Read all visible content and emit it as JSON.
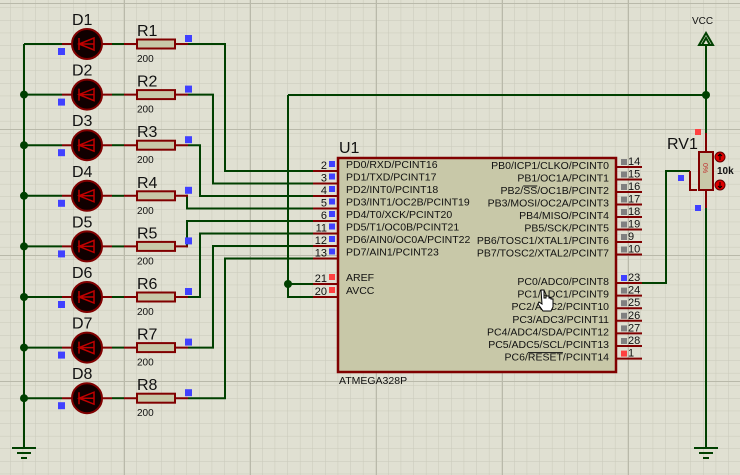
{
  "colors": {
    "wire": "#004000",
    "component": "#800000",
    "body": "#c8c8a8",
    "background": "#e0e0d2",
    "pin_low": "#4040ff",
    "pin_high": "#ff4040",
    "pin_float": "#808080"
  },
  "leds": [
    {
      "label": "D1"
    },
    {
      "label": "D2"
    },
    {
      "label": "D3"
    },
    {
      "label": "D4"
    },
    {
      "label": "D5"
    },
    {
      "label": "D6"
    },
    {
      "label": "D7"
    },
    {
      "label": "D8"
    }
  ],
  "resistors": [
    {
      "label": "R1",
      "value": "200"
    },
    {
      "label": "R2",
      "value": "200"
    },
    {
      "label": "R3",
      "value": "200"
    },
    {
      "label": "R4",
      "value": "200"
    },
    {
      "label": "R5",
      "value": "200"
    },
    {
      "label": "R6",
      "value": "200"
    },
    {
      "label": "R7",
      "value": "200"
    },
    {
      "label": "R8",
      "value": "200"
    }
  ],
  "chip": {
    "ref": "U1",
    "part": "ATMEGA328P",
    "left_pins": [
      {
        "num": "2",
        "name": "PD0/RXD/PCINT16",
        "state": "low"
      },
      {
        "num": "3",
        "name": "PD1/TXD/PCINT17",
        "state": "low"
      },
      {
        "num": "4",
        "name": "PD2/INT0/PCINT18",
        "state": "low"
      },
      {
        "num": "5",
        "name": "PD3/INT1/OC2B/PCINT19",
        "state": "low"
      },
      {
        "num": "6",
        "name": "PD4/T0/XCK/PCINT20",
        "state": "low"
      },
      {
        "num": "11",
        "name": "PD5/T1/OC0B/PCINT21",
        "state": "low"
      },
      {
        "num": "12",
        "name": "PD6/AIN0/OC0A/PCINT22",
        "state": "low"
      },
      {
        "num": "13",
        "name": "PD7/AIN1/PCINT23",
        "state": "low"
      }
    ],
    "analog_pins": [
      {
        "num": "21",
        "name": "AREF",
        "state": "high"
      },
      {
        "num": "20",
        "name": "AVCC",
        "state": "high"
      }
    ],
    "right_pins_b": [
      {
        "num": "14",
        "name": "PB0/ICP1/CLKO/PCINT0",
        "state": "float"
      },
      {
        "num": "15",
        "name": "PB1/OC1A/PCINT1",
        "state": "float"
      },
      {
        "num": "16",
        "name": "PB2/SS/OC1B/PCINT2",
        "overline": "SS",
        "state": "float"
      },
      {
        "num": "17",
        "name": "PB3/MOSI/OC2A/PCINT3",
        "state": "float"
      },
      {
        "num": "18",
        "name": "PB4/MISO/PCINT4",
        "state": "float"
      },
      {
        "num": "19",
        "name": "PB5/SCK/PCINT5",
        "state": "float"
      },
      {
        "num": "9",
        "name": "PB6/TOSC1/XTAL1/PCINT6",
        "state": "float"
      },
      {
        "num": "10",
        "name": "PB7/TOSC2/XTAL2/PCINT7",
        "state": "float"
      }
    ],
    "right_pins_c": [
      {
        "num": "23",
        "name": "PC0/ADC0/PCINT8",
        "state": "low"
      },
      {
        "num": "24",
        "name": "PC1/ADC1/PCINT9",
        "state": "float"
      },
      {
        "num": "25",
        "name": "PC2/ADC2/PCINT10",
        "state": "float"
      },
      {
        "num": "26",
        "name": "PC3/ADC3/PCINT11",
        "state": "float"
      },
      {
        "num": "27",
        "name": "PC4/ADC4/SDA/PCINT12",
        "state": "float"
      },
      {
        "num": "28",
        "name": "PC5/ADC5/SCL/PCINT13",
        "state": "float"
      },
      {
        "num": "1",
        "name": "PC6/RESET/PCINT14",
        "overline": "RESET",
        "state": "high"
      }
    ]
  },
  "pot": {
    "label": "RV1",
    "value": "10k",
    "position": "0%"
  },
  "power": {
    "label": "VCC"
  }
}
